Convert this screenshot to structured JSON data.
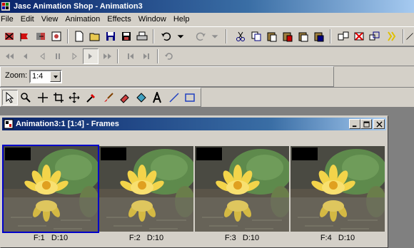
{
  "window": {
    "title": "Jasc Animation Shop - Animation3",
    "app_icon": "jasc-app-icon"
  },
  "menu": [
    "File",
    "Edit",
    "View",
    "Animation",
    "Effects",
    "Window",
    "Help"
  ],
  "standard_toolbar": [
    "animation-wizard-icon",
    "banner-wizard-icon",
    "transition-icon",
    "image-effect-icon",
    "new-icon",
    "open-icon",
    "save-icon",
    "save-as-icon",
    "print-icon",
    "undo-icon",
    "undo-dropdown-icon",
    "redo-icon",
    "redo-dropdown-icon",
    "cut-icon",
    "copy-icon",
    "paste-as-new-icon",
    "paste-into-icon",
    "paste-before-icon",
    "paste-after-icon",
    "insert-frames-icon",
    "delete-frames-icon",
    "resize-icon",
    "optimize-icon"
  ],
  "playback_toolbar": [
    "first-frame-icon",
    "previous-frame-icon",
    "play-backward-icon",
    "stop-icon",
    "play-forward-icon",
    "next-frame-icon",
    "last-frame-icon",
    "step-back-icon",
    "step-forward-icon",
    "refresh-icon"
  ],
  "zoom": {
    "label": "Zoom:",
    "value": "1:4"
  },
  "tools": [
    "arrow-tool-icon",
    "zoom-tool-icon",
    "crosshair-tool-icon",
    "crop-tool-icon",
    "mover-tool-icon",
    "dropper-tool-icon",
    "paintbrush-tool-icon",
    "eraser-tool-icon",
    "fill-tool-icon",
    "text-tool-icon",
    "line-tool-icon",
    "rectangle-tool-icon"
  ],
  "active_tool": "arrow-tool-icon",
  "child_window": {
    "title": "Animation3:1 [1:4] - Frames",
    "buttons": [
      "minimize-icon",
      "maximize-icon",
      "close-icon"
    ]
  },
  "frames": [
    {
      "frame": "F:1",
      "delay": "D:10",
      "selected": true
    },
    {
      "frame": "F:2",
      "delay": "D:10",
      "selected": false
    },
    {
      "frame": "F:3",
      "delay": "D:10",
      "selected": false
    },
    {
      "frame": "F:4",
      "delay": "D:10",
      "selected": false
    }
  ],
  "colors": {
    "title_active": "#0a246a",
    "face": "#d4d0c8",
    "workspace": "#808080",
    "selection": "#0000c8"
  }
}
